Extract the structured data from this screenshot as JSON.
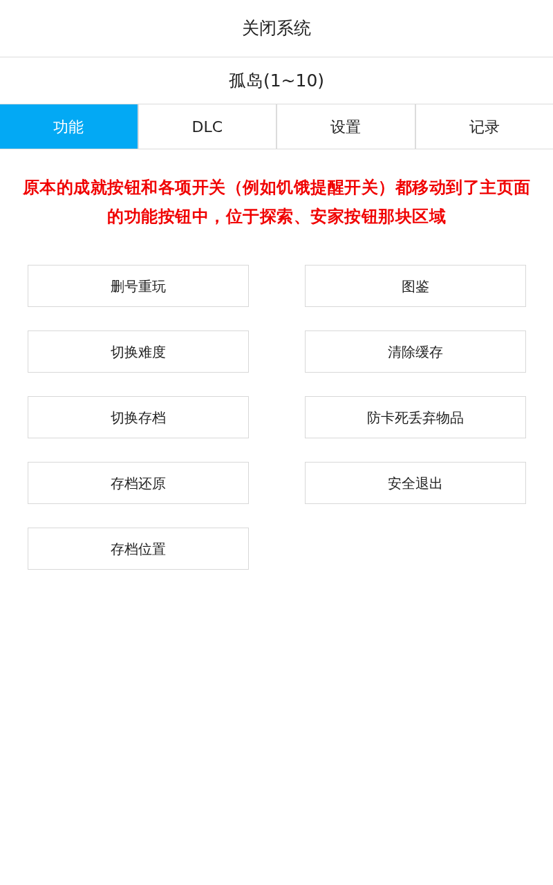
{
  "header": {
    "title": "关闭系统"
  },
  "game": {
    "title": "孤岛(1~10)"
  },
  "tabs": [
    {
      "label": "功能",
      "selected": true
    },
    {
      "label": "DLC",
      "selected": false
    },
    {
      "label": "设置",
      "selected": false
    },
    {
      "label": "记录",
      "selected": false
    }
  ],
  "notice": {
    "text": "原本的成就按钮和各项开关（例如饥饿提醒开关）都移动到了主页面的功能按钮中，位于探索、安家按钮那块区域"
  },
  "buttons": [
    "删号重玩",
    "图鉴",
    "切换难度",
    "清除缓存",
    "切换存档",
    "防卡死丢弃物品",
    "存档还原",
    "安全退出",
    "存档位置"
  ]
}
